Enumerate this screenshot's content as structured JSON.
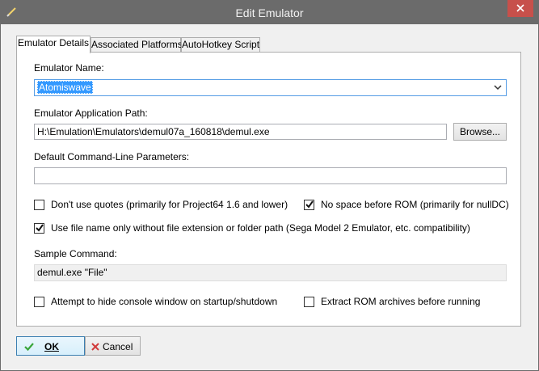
{
  "window": {
    "title": "Edit Emulator",
    "app_icon": "pencil-icon",
    "close_icon": "close-icon"
  },
  "tabs": [
    {
      "label": "Emulator Details",
      "active": true
    },
    {
      "label": "Associated Platforms",
      "active": false
    },
    {
      "label": "AutoHotkey Script",
      "active": false
    }
  ],
  "details": {
    "emulator_name_label": "Emulator Name:",
    "emulator_name_value": "Atomiswave",
    "app_path_label": "Emulator Application Path:",
    "app_path_value": "H:\\Emulation\\Emulators\\demul07a_160818\\demul.exe",
    "browse_label": "Browse...",
    "params_label": "Default Command-Line Parameters:",
    "params_value": "",
    "dont_use_quotes": {
      "label": "Don't use quotes (primarily for Project64 1.6 and lower)",
      "checked": false
    },
    "no_space_before_rom": {
      "label": "No space before ROM (primarily for nullDC)",
      "checked": true
    },
    "file_name_only": {
      "label": "Use file name only without file extension or folder path (Sega Model 2 Emulator, etc. compatibility)",
      "checked": true
    },
    "sample_command_label": "Sample Command:",
    "sample_command_value": "demul.exe \"File\"",
    "hide_console": {
      "label": "Attempt to hide console window on startup/shutdown",
      "checked": false
    },
    "extract_rom": {
      "label": "Extract ROM archives before running",
      "checked": false
    }
  },
  "buttons": {
    "ok_label": "OK",
    "ok_icon": "checkmark-icon",
    "cancel_label": "Cancel",
    "cancel_icon": "x-icon"
  },
  "colors": {
    "titlebar": "#6b6b6b",
    "close": "#c7504b",
    "selection": "#3399ff",
    "ok_check": "#3aa53a",
    "cancel_x": "#d13a3a"
  }
}
